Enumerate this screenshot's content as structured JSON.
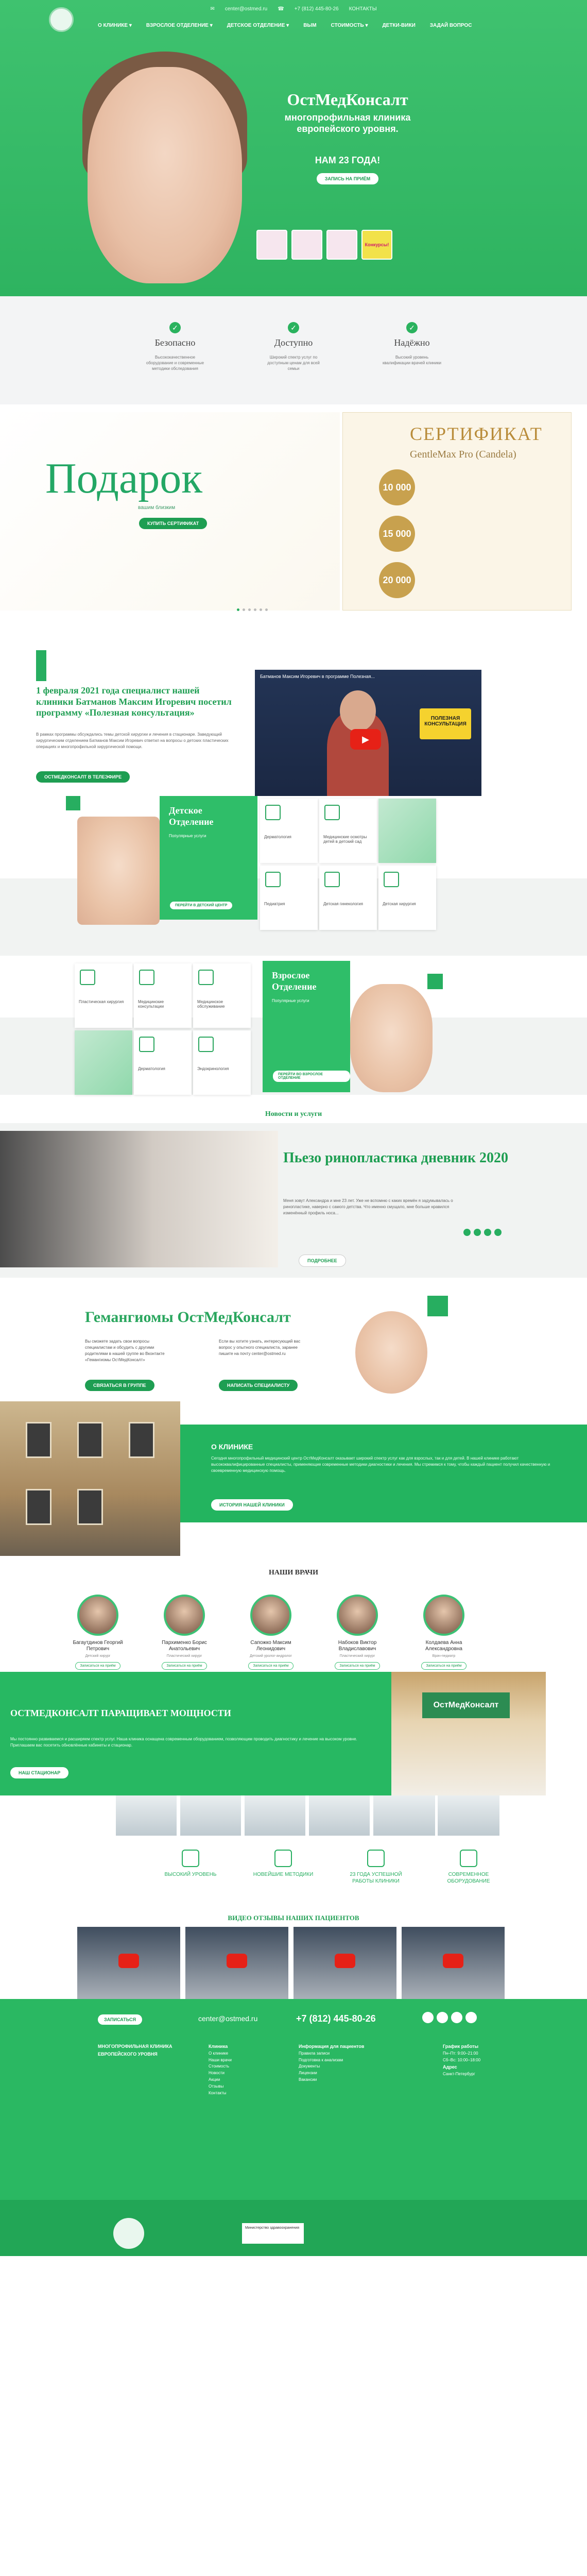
{
  "header": {
    "email": "center@ostmed.ru",
    "phone": "+7 (812) 445-80-26",
    "contacts": "КОНТАКТЫ",
    "nav": [
      "О КЛИНИКЕ ▾",
      "ВЗРОСЛОЕ ОТДЕЛЕНИЕ ▾",
      "ДЕТСКОЕ ОТДЕЛЕНИЕ ▾",
      "ВЫМ",
      "СТОИМОСТЬ ▾",
      "ДЕТКИ-ВИКИ",
      "ЗАДАЙ ВОПРОС"
    ]
  },
  "hero": {
    "title": "ОстМедКонсалт",
    "subtitle": "многопрофильная клиника европейского уровня.",
    "years": "НАМ 23 ГОДА!",
    "cta": "ЗАПИСЬ НА ПРИЁМ",
    "promo4": "Конкурсы!"
  },
  "benefits": [
    {
      "title": "Безопасно",
      "text": "Высококачественное оборудование и современные методики обследования"
    },
    {
      "title": "Доступно",
      "text": "Широкий спектр услуг по доступным ценам для всей семьи"
    },
    {
      "title": "Надёжно",
      "text": "Высокий уровень квалификации врачей клиники"
    }
  ],
  "gift": {
    "word": "Подарок",
    "sub": "вашим близким",
    "cta": "КУПИТЬ СЕРТИФИКАТ",
    "cert_title": "СЕРТИФИКАТ",
    "cert_sub": "GentleMax Pro (Candela)",
    "coins": [
      "10 000",
      "15 000",
      "20 000"
    ]
  },
  "newsvideo": {
    "title": "1 февраля 2021 года специалист нашей клиники Батманов Максим Игоревич посетил программу «Полезная консультация»",
    "text": "В рамках программы обсуждались темы детской хирургии и лечения в стационаре. Заведующий хирургическим отделением Батманов Максим Игоревич ответил на вопросы о детских пластических операциях и многопрофильной хирургической помощи.",
    "button": "ОСТМЕДКОНСАЛТ В ТЕЛЕЭФИРЕ",
    "video_title": "Батманов Максим Игоревич в программе Полезная...",
    "video_badge": "ПОЛЕЗНАЯ КОНСУЛЬТАЦИЯ"
  },
  "kids": {
    "title": "Детское Отделение",
    "list": "Популярные услуги",
    "button": "ПЕРЕЙТИ В ДЕТСКИЙ ЦЕНТР",
    "cards": [
      "Дерматология",
      "Медицинские осмотры детей в детский сад",
      "Педиатрия",
      "Детская гинекология",
      "Детская хирургия",
      "Физиотерапия и восстановление"
    ]
  },
  "adults": {
    "title": "Взрослое Отделение",
    "list": "Популярные услуги",
    "button": "ПЕРЕЙТИ ВО ВЗРОСЛОЕ ОТДЕЛЕНИЕ",
    "cards": [
      "Пластическая хирургия",
      "Медицинские консультации",
      "Медицинское обслуживание",
      "Дерматология",
      "Эндокринология"
    ]
  },
  "news": {
    "header": "Новости и услуги",
    "title": "Пьезо ринопластика дневник 2020",
    "text": "Меня зовут Александра и мне 23 лет. Уже не вспомню с каких времён я задумывалась о ринопластике, наверно с самого детства. Что именно смущало, мне больше нравился изменённый профиль носа...",
    "button": "ПОДРОБНЕЕ"
  },
  "hem": {
    "title": "Гемангиомы ОстМедКонсалт",
    "col1": "Вы сможете задать свои вопросы специалистам и обсудить с другими родителями в нашей группе во Вконтакте «Гемангиомы ОстМедКонсалт»",
    "col2": "Если вы хотите узнать, интересующий вас вопрос у опытного специалиста, заранее пишите на почту center@ostmed.ru",
    "b1": "СВЯЗАТЬСЯ В ГРУППЕ",
    "b2": "НАПИСАТЬ СПЕЦИАЛИСТУ"
  },
  "about": {
    "title": "О КЛИНИКЕ",
    "text": "Сегодня многопрофильный медицинский центр ОстМедКонсалт оказывает широкий спектр услуг как для взрослых, так и для детей. В нашей клинике работают высококвалифицированные специалисты, применяющие современные методики диагностики и лечения. Мы стремимся к тому, чтобы каждый пациент получил качественную и своевременную медицинскую помощь.",
    "button": "ИСТОРИЯ НАШЕЙ КЛИНИКИ"
  },
  "doctors": {
    "title": "НАШИ ВРАЧИ",
    "list": [
      {
        "name": "Багаутдинов Георгий Петрович",
        "role": "Детский хирург",
        "btn": "Записаться на приём"
      },
      {
        "name": "Пархименко Борис Анатольевич",
        "role": "Пластический хирург",
        "btn": "Записаться на приём"
      },
      {
        "name": "Сапожко Максим Леонидович",
        "role": "Детский уролог-андролог",
        "btn": "Записаться на приём"
      },
      {
        "name": "Набоков Виктор Владиславович",
        "role": "Пластический хирург",
        "btn": "Записаться на приём"
      },
      {
        "name": "Колдаева Анна Александровна",
        "role": "Врач-педиатр",
        "btn": "Записаться на приём"
      }
    ]
  },
  "facilities": {
    "title": "ОСТМЕДКОНСАЛТ ПАРАЩИВАЕТ МОЩНОСТИ",
    "text": "Мы постоянно развиваемся и расширяем спектр услуг. Наша клиника оснащена современным оборудованием, позволяющим проводить диагностику и лечение на высоком уровне. Приглашаем вас посетить обновлённые кабинеты и стационар.",
    "button": "НАШ СТАЦИОНАР",
    "sign": "ОстМедКонсалт"
  },
  "features": [
    "ВЫСОКИЙ УРОВЕНЬ",
    "НОВЕЙШИЕ МЕТОДИКИ",
    "23 ГОДА УСПЕШНОЙ РАБОТЫ КЛИНИКИ",
    "СОВРЕМЕННОЕ ОБОРУДОВАНИЕ"
  ],
  "reviews": {
    "title": "ВИДЕО ОТЗЫВЫ НАШИХ ПАЦИЕНТОВ"
  },
  "footer": {
    "sign": "ЗАПИСАТЬСЯ",
    "email": "center@ostmed.ru",
    "phone": "+7 (812) 445-80-26",
    "about": "МНОГОПРОФИЛЬНАЯ КЛИНИКА ЕВРОПЕЙСКОГО УРОВНЯ",
    "col2_title": "Клиника",
    "col2": [
      "О клинике",
      "Наши врачи",
      "Стоимость",
      "Новости",
      "Акции",
      "Отзывы",
      "Контакты"
    ],
    "col3_title": "Информация для пациентов",
    "col3": [
      "Правила записи",
      "Подготовка к анализам",
      "Документы",
      "Лицензии",
      "Вакансии"
    ],
    "col4_title": "График работы",
    "col4": [
      "Пн–Пт: 9:00–21:00",
      "Сб–Вс: 10:00–18:00"
    ],
    "addr_title": "Адрес",
    "addr": "Санкт-Петербург",
    "gov": "Министерство здравоохранения"
  }
}
